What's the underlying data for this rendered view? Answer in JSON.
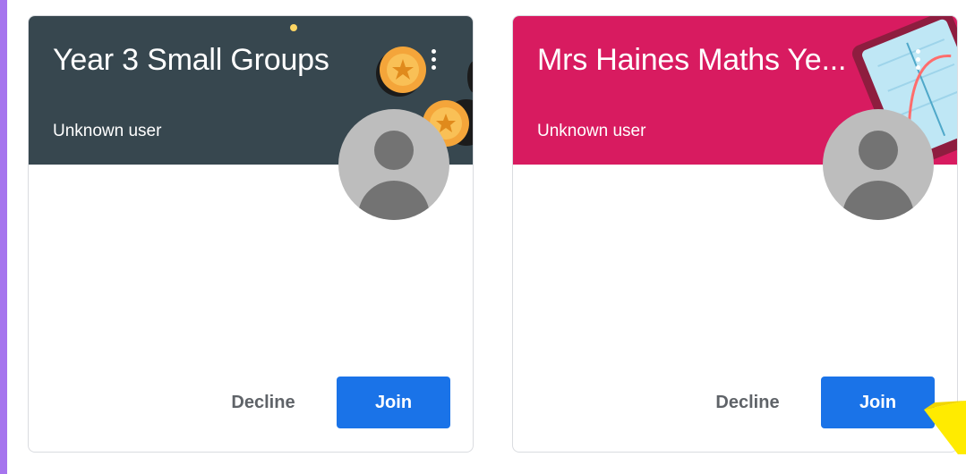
{
  "classes": [
    {
      "title": "Year 3 Small Groups",
      "owner": "Unknown user",
      "banner_color": "#37474f",
      "banner_theme": "gold-coins",
      "decline_label": "Decline",
      "join_label": "Join"
    },
    {
      "title": "Mrs Haines Maths Ye...",
      "owner": "Unknown user",
      "banner_color": "#d81b60",
      "banner_theme": "maths-tablet",
      "decline_label": "Decline",
      "join_label": "Join"
    }
  ],
  "icons": {
    "menu": "more-vert-icon",
    "avatar": "default-avatar-icon",
    "pointer": "arrow-pointer-icon"
  },
  "colors": {
    "join_button": "#1a73e8",
    "page_border": "#a675ee",
    "pointer": "#ffeb00"
  }
}
